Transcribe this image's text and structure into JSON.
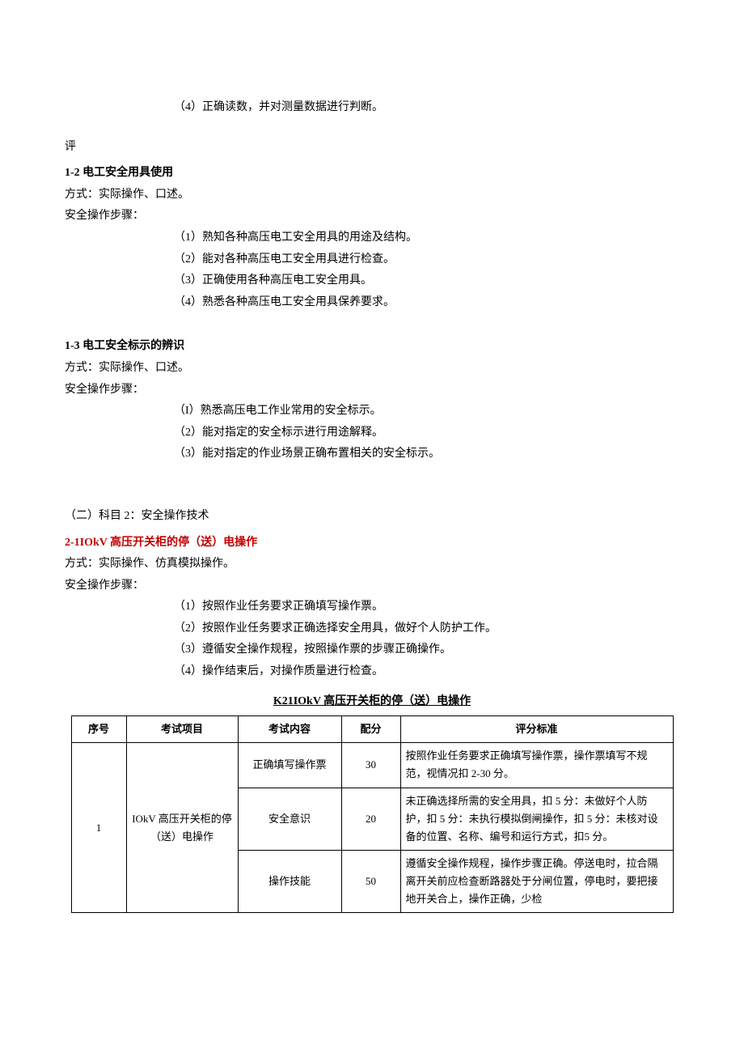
{
  "intro_step4": "（4）正确读数，并对测量数据进行判断。",
  "eval_char": "评",
  "s12": {
    "title": "1-2 电工安全用具使用",
    "method": "方式：实际操作、口述。",
    "steps_label": "安全操作步骤：",
    "steps": [
      "（1）熟知各种高压电工安全用具的用途及结构。",
      "（2）能对各种高压电工安全用具进行检查。",
      "（3）正确使用各种高压电工安全用具。",
      "（4）熟悉各种高压电工安全用具保养要求。"
    ]
  },
  "s13": {
    "title": "1-3 电工安全标示的辨识",
    "method": "方式：实际操作、口述。",
    "steps_label": "安全操作步骤：",
    "steps": [
      "（I）熟悉高压电工作业常用的安全标示。",
      "（2）能对指定的安全标示进行用途解释。",
      "（3）能对指定的作业场景正确布置相关的安全标示。"
    ]
  },
  "subj2_heading": "（二）科目 2：安全操作技术",
  "s21": {
    "title": "2-1IOkV 高压开关柜的停（送）电操作",
    "method": "方式：实际操作、仿真模拟操作。",
    "steps_label": "安全操作步骤：",
    "steps": [
      "（1）按照作业任务要求正确填写操作票。",
      "（2）按照作业任务要求正确选择安全用具，做好个人防护工作。",
      "（3）遵循安全操作规程，按照操作票的步骤正确操作。",
      "（4）操作结束后，对操作质量进行检查。"
    ]
  },
  "table": {
    "caption": "K21IOkV 高压开关柜的停（送）电操作",
    "headers": [
      "序号",
      "考试项目",
      "考试内容",
      "配分",
      "评分标准"
    ],
    "seq": "1",
    "project": "IOkV 高压开关柜的停（送）电操作",
    "rows": [
      {
        "content": "正确填写操作票",
        "score": "30",
        "criteria": "按照作业任务要求正确填写操作票，操作票填写不规范，视情况扣 2-30 分。"
      },
      {
        "content": "安全意识",
        "score": "20",
        "criteria": "未正确选择所需的安全用具，扣 5 分：未做好个人防护，扣 5 分：未执行模拟倒闸操作，扣 5 分：未核对设备的位置、名称、编号和运行方式，扣5 分。"
      },
      {
        "content": "操作技能",
        "score": "50",
        "criteria": "遵循安全操作规程，操作步骤正确。停送电时，拉合隔离开关前应检查断路器处于分闸位置，停电时，要把接地开关合上，操作正确，少检"
      }
    ]
  }
}
